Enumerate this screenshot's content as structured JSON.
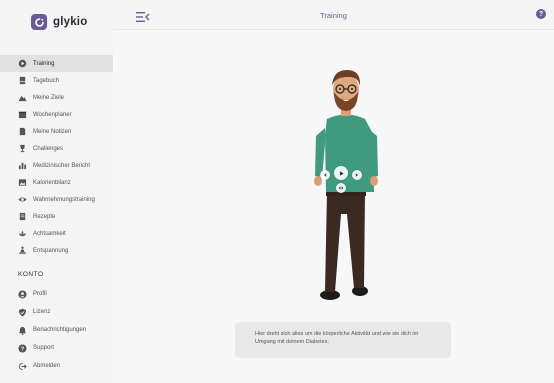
{
  "app": {
    "brand": "glykio"
  },
  "header": {
    "title": "Training"
  },
  "nav": [
    {
      "id": "training",
      "label": "Training",
      "icon": "training-icon",
      "active": true
    },
    {
      "id": "tagebuch",
      "label": "Tagebuch",
      "icon": "diary-icon",
      "active": false
    },
    {
      "id": "ziele",
      "label": "Meine Ziele",
      "icon": "mountain-icon",
      "active": false
    },
    {
      "id": "wochenplaner",
      "label": "Wochenplaner",
      "icon": "calendar-icon",
      "active": false
    },
    {
      "id": "notizen",
      "label": "Meine Notizen",
      "icon": "note-icon",
      "active": false
    },
    {
      "id": "challenges",
      "label": "Challenges",
      "icon": "trophy-icon",
      "active": false
    },
    {
      "id": "bericht",
      "label": "Medizinischer Bericht",
      "icon": "bar-chart-icon",
      "active": false
    },
    {
      "id": "kalorien",
      "label": "Kalorienbilanz",
      "icon": "image-icon",
      "active": false
    },
    {
      "id": "wahrnehmung",
      "label": "Wahrnehmungstraining",
      "icon": "eye-icon",
      "active": false
    },
    {
      "id": "rezepte",
      "label": "Rezepte",
      "icon": "recipe-icon",
      "active": false
    },
    {
      "id": "achtsamkeit",
      "label": "Achtsamkeit",
      "icon": "lotus-icon",
      "active": false
    },
    {
      "id": "entspannung",
      "label": "Entspannung",
      "icon": "meditation-icon",
      "active": false
    }
  ],
  "account": {
    "title": "KONTO",
    "items": [
      {
        "id": "profil",
        "label": "Profil",
        "icon": "user-icon"
      },
      {
        "id": "lizenz",
        "label": "Lizenz",
        "icon": "shield-check-icon"
      },
      {
        "id": "benachrichtigungen",
        "label": "Benachrichtigungen",
        "icon": "bell-icon"
      },
      {
        "id": "support",
        "label": "Support",
        "icon": "help-icon"
      },
      {
        "id": "abmelden",
        "label": "Abmelden",
        "icon": "logout-icon"
      }
    ]
  },
  "main": {
    "info_text": "Hier dreht sich alles um die körperliche Aktivität und wie sie dich im Umgang mit deinem Diabetes."
  },
  "colors": {
    "brand": "#6b5b95",
    "sweater": "#3f9a7f",
    "pants": "#3a2a22"
  }
}
